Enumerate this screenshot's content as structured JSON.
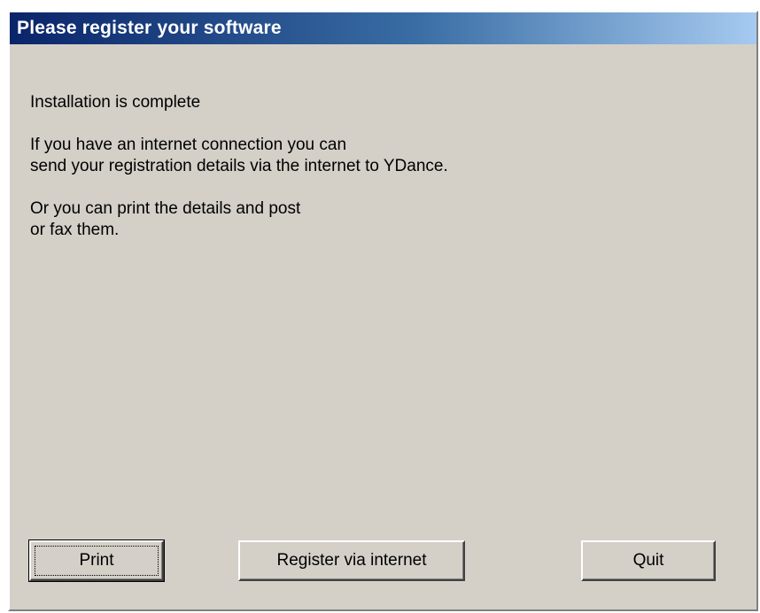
{
  "dialog": {
    "title": "Please register your software",
    "paragraphs": {
      "line1": "Installation is complete",
      "line2": "If you have an internet connection you can",
      "line3": "send your registration details via the internet to YDance.",
      "line4": "Or you can print the details and post",
      "line5": "or fax them."
    },
    "buttons": {
      "print": "Print",
      "register": "Register via internet",
      "quit": "Quit"
    }
  },
  "colors": {
    "title_start": "#0a246a",
    "title_end": "#a6caf0",
    "face": "#d4d0c8"
  }
}
